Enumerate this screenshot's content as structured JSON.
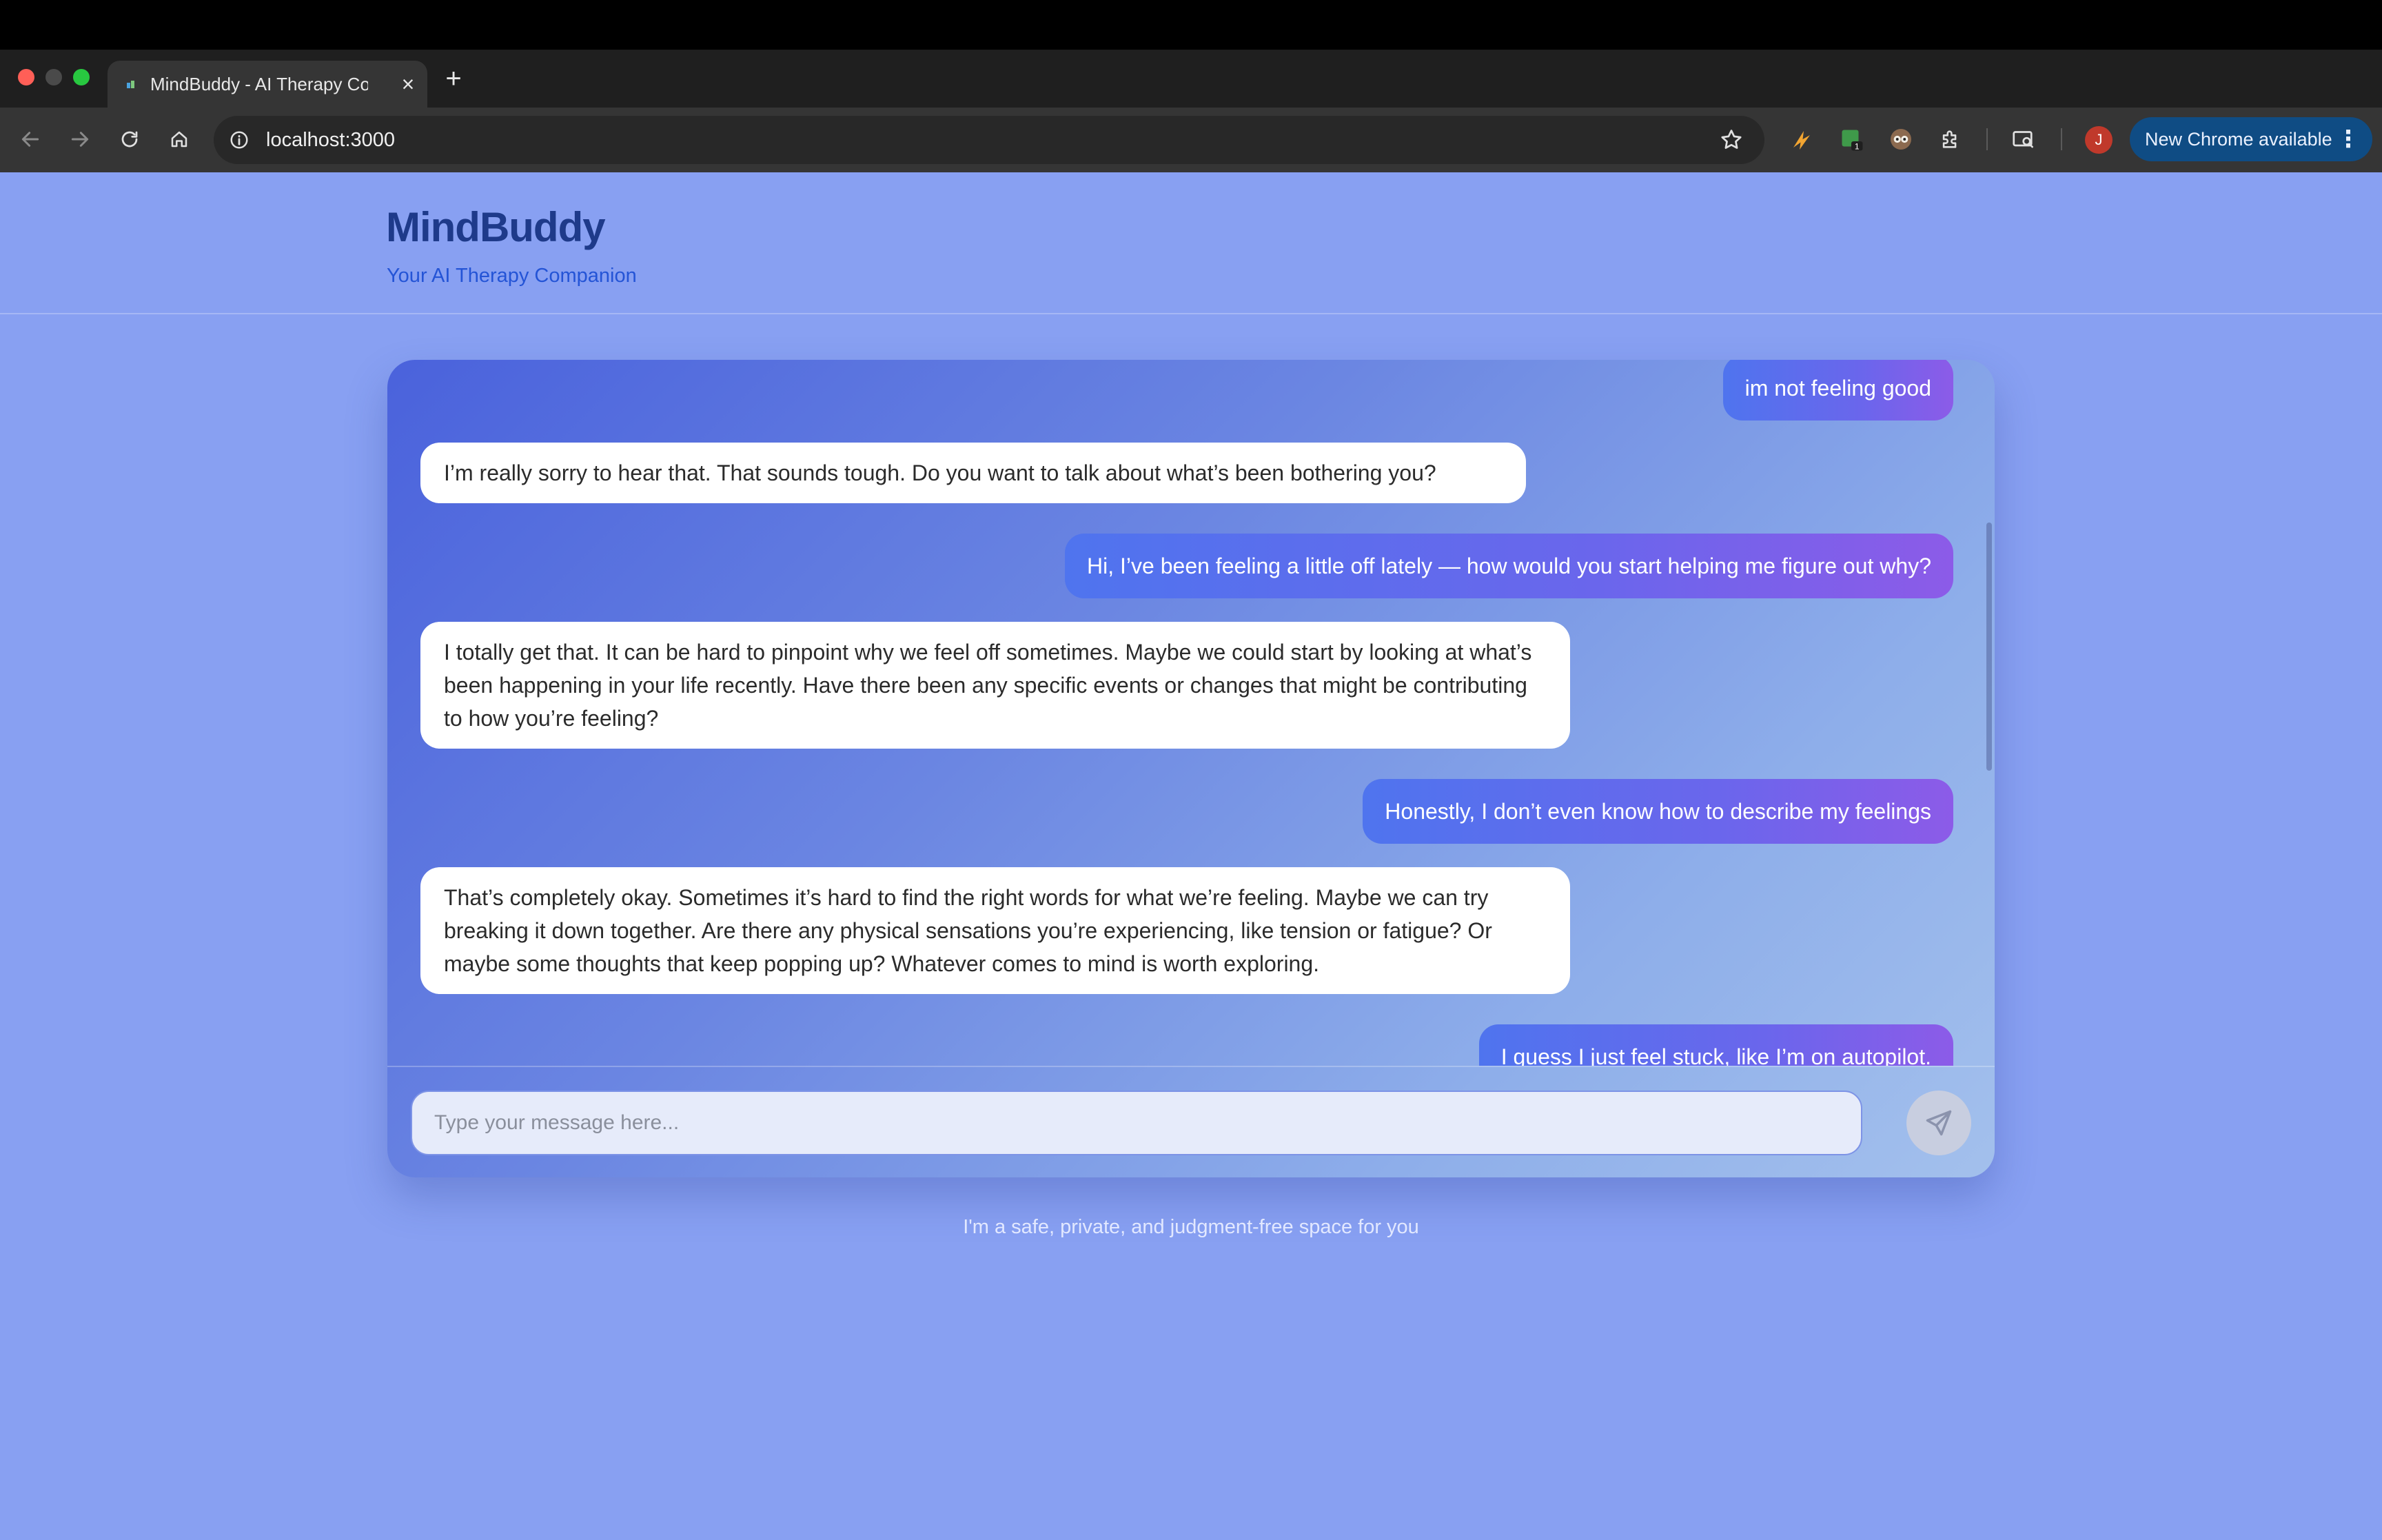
{
  "browser": {
    "tab_title": "MindBuddy - AI Therapy Companion",
    "url": "localhost:3000",
    "update_label": "New Chrome available",
    "update_menu": "⋮",
    "profile_initial": "J",
    "extension_badge": "1",
    "tab_close": "×",
    "new_tab": "+",
    "traffic_colors": [
      "#ff5f57",
      "#4a4a4a",
      "#28c840"
    ],
    "icons": [
      "back-icon",
      "forward-icon",
      "reload-icon",
      "home-icon",
      "info-icon",
      "star-icon",
      "extension-lightning-icon",
      "extension-green-icon",
      "extension-owl-icon",
      "puzzle-icon",
      "tab-search-icon"
    ]
  },
  "app": {
    "title": "MindBuddy",
    "tagline": "Your AI Therapy Companion",
    "footer": "I'm a safe, private, and judgment-free space for you",
    "input_placeholder": "Type your message here...",
    "send_icon": "send-icon",
    "colors": {
      "background": "#88a0f2",
      "brand": "#1e3a8a",
      "tagline": "#2454d6",
      "user_bubble_start": "#4f74ee",
      "user_bubble_end": "#8c5be8",
      "bot_bubble": "#ffffff"
    }
  },
  "messages": [
    {
      "role": "user",
      "text": "im not feeling good"
    },
    {
      "role": "bot",
      "text": "I’m really sorry to hear that. That sounds tough. Do you want to talk about what’s been bothering you?"
    },
    {
      "role": "user",
      "text": "Hi, I’ve been feeling a little off lately — how would you start helping me figure out why?"
    },
    {
      "role": "bot",
      "text": "I totally get that. It can be hard to pinpoint why we feel off sometimes. Maybe we could start by looking at what’s been happening in your life recently. Have there been any specific events or changes that might be contributing to how you’re feeling?"
    },
    {
      "role": "user",
      "text": "Honestly, I don’t even know how to describe my feelings"
    },
    {
      "role": "bot",
      "text": "That’s completely okay. Sometimes it’s hard to find the right words for what we’re feeling. Maybe we can try breaking it down together. Are there any physical sensations you’re experiencing, like tension or fatigue? Or maybe some thoughts that keep popping up? Whatever comes to mind is worth exploring."
    },
    {
      "role": "user",
      "text": "I guess I just feel stuck, like I’m on autopilot."
    }
  ]
}
